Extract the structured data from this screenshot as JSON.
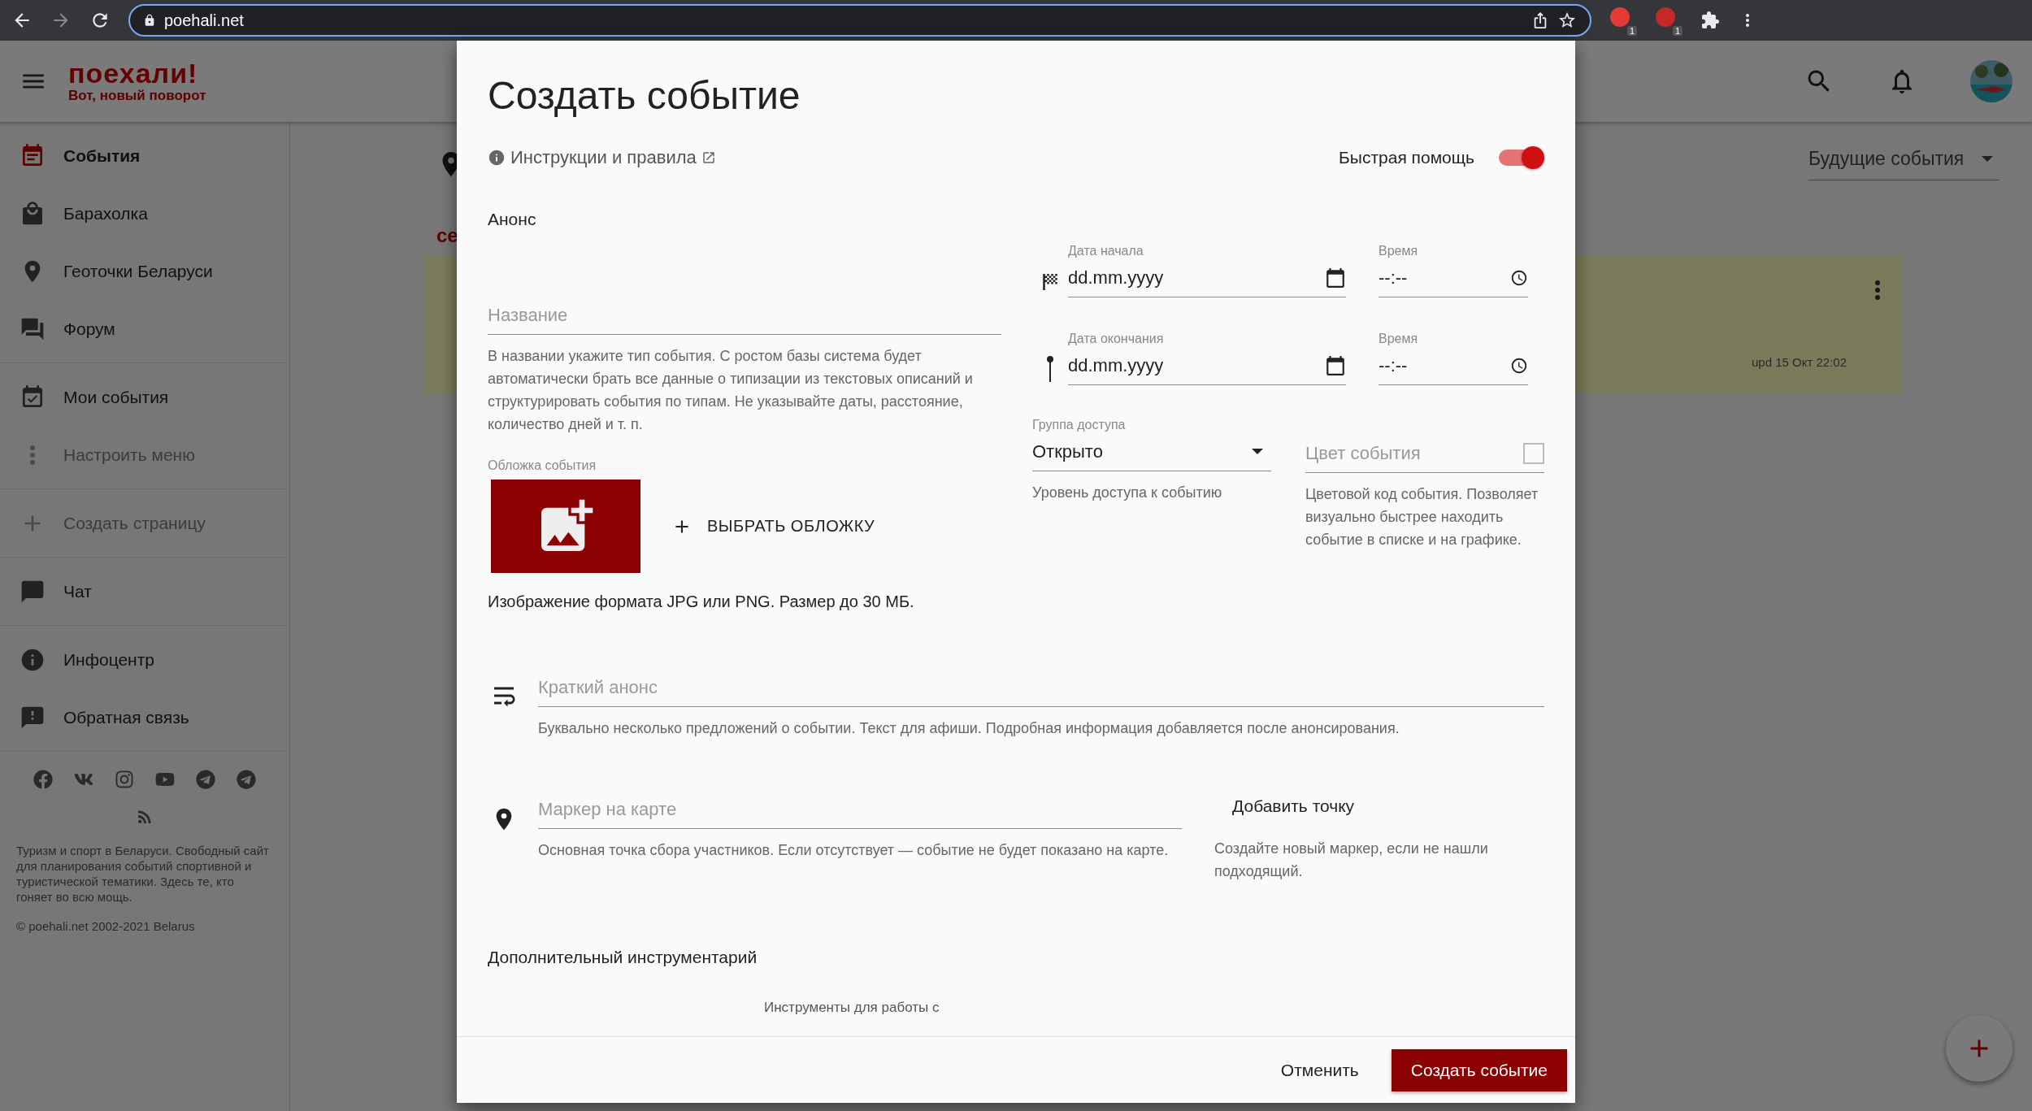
{
  "browser": {
    "url": "poehali.net",
    "extension_badges": [
      "1",
      "1"
    ]
  },
  "app_bar": {
    "logo": "поехали!",
    "tagline": "Вот, новый поворот"
  },
  "sidebar": {
    "groups": [
      [
        {
          "label": "События",
          "selected": true,
          "kind": "link"
        },
        {
          "label": "Барахолка",
          "selected": false,
          "kind": "link"
        },
        {
          "label": "Геоточки Беларуси",
          "selected": false,
          "kind": "link"
        },
        {
          "label": "Форум",
          "selected": false,
          "kind": "link"
        }
      ],
      [
        {
          "label": "Мои события",
          "selected": false,
          "kind": "link"
        },
        {
          "label": "Настроить меню",
          "selected": false,
          "kind": "action"
        }
      ],
      [
        {
          "label": "Создать страницу",
          "selected": false,
          "kind": "action"
        }
      ],
      [
        {
          "label": "Чат",
          "selected": false,
          "kind": "link"
        }
      ],
      [
        {
          "label": "Инфоцентр",
          "selected": false,
          "kind": "link"
        },
        {
          "label": "Обратная связь",
          "selected": false,
          "kind": "link"
        }
      ]
    ],
    "about": "Туризм и спорт в Беларуси. Свободный сайт для планирования событий спортивной и туристической тематики. Здесь те, кто гоняет во всю мощь.",
    "copyright": "© poehali.net 2002-2021 Belarus"
  },
  "main": {
    "partial_heading": "се",
    "filter": "Будущие события",
    "card": {
      "updated": "upd 15 Окт 22:02"
    }
  },
  "dialog": {
    "title": "Создать событие",
    "instructions_link": "Инструкции и правила",
    "quick_help": {
      "label": "Быстрая помощь",
      "on": true
    },
    "section": "Анонс",
    "name_field": {
      "placeholder": "Название",
      "helper": "В названии укажите тип события. С ростом базы система будет автоматически брать все данные о типизации из текстовых описаний и структурировать события по типам. Не указывайте даты, расстояние, количество дней и т. п."
    },
    "start": {
      "date_label": "Дата начала",
      "date_value": "dd.mm.yyyy",
      "time_label": "Время",
      "time_value": "--:--"
    },
    "end": {
      "date_label": "Дата окончания",
      "date_value": "dd.mm.yyyy",
      "time_label": "Время",
      "time_value": "--:--"
    },
    "cover": {
      "label": "Обложка события",
      "button": "ВЫБРАТЬ ОБЛОЖКУ",
      "note": "Изображение формата JPG или PNG. Размер до 30 МБ."
    },
    "access": {
      "label": "Группа доступа",
      "value": "Открыто",
      "helper": "Уровень доступа к событию"
    },
    "color": {
      "placeholder": "Цвет события",
      "checked": false,
      "helper": "Цветовой код события. Позволяет визуально быстрее находить событие в списке и на графике."
    },
    "summary": {
      "placeholder": "Краткий анонс",
      "helper": "Буквально несколько предложений о событии. Текст для афиши. Подробная информация добавляется после анонсирования."
    },
    "marker": {
      "placeholder": "Маркер на карте",
      "helper": "Основная точка сбора участников. Если отсутствует — событие не будет показано на карте."
    },
    "add_point": {
      "button": "Добавить точку",
      "helper": "Создайте новый маркер, если не нашли подходящий."
    },
    "tools": {
      "heading": "Дополнительный инструментарий",
      "text": "Инструменты для работы с"
    },
    "actions": {
      "cancel": "Отменить",
      "submit": "Создать событие"
    }
  }
}
